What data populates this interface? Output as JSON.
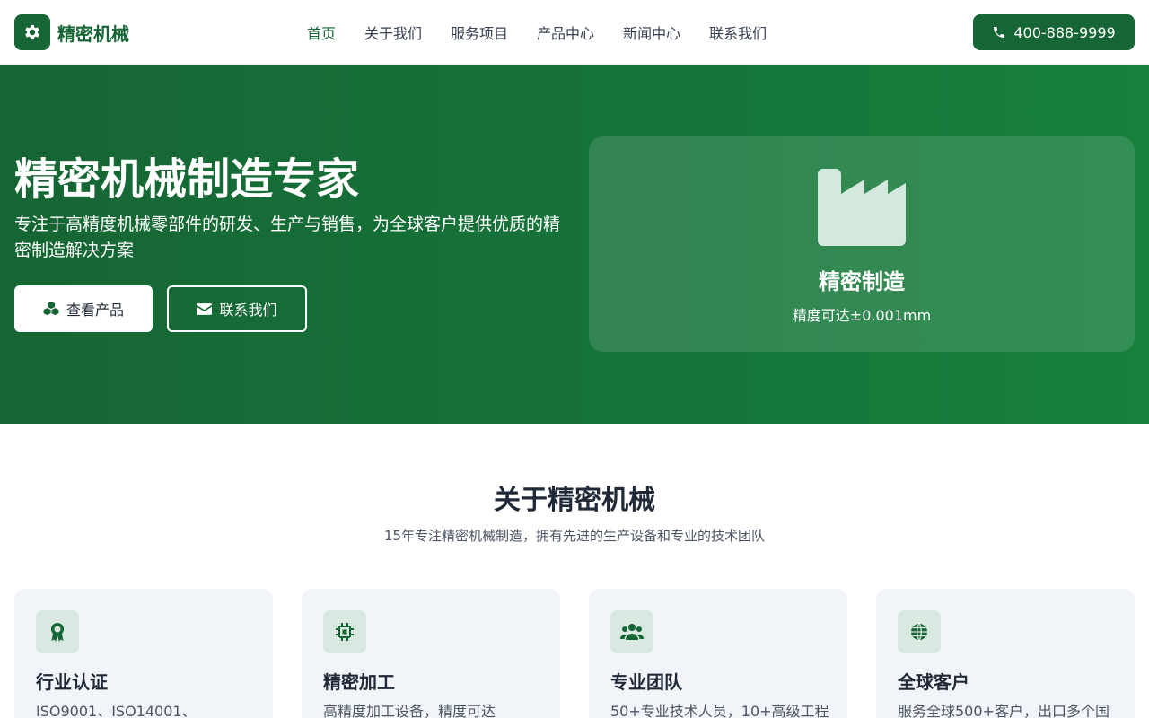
{
  "brand": {
    "name": "精密机械",
    "accent_color": "#166534",
    "logo_icon": "gear-icon"
  },
  "nav": {
    "items": [
      {
        "label": "首页",
        "active": true
      },
      {
        "label": "关于我们",
        "active": false
      },
      {
        "label": "服务项目",
        "active": false
      },
      {
        "label": "产品中心",
        "active": false
      },
      {
        "label": "新闻中心",
        "active": false
      },
      {
        "label": "联系我们",
        "active": false
      }
    ],
    "phone": "400-888-9999",
    "phone_icon": "phone-icon"
  },
  "hero": {
    "title": "精密机械制造专家",
    "description": "专注于高精度机械零部件的研发、生产与销售，为全球客户提供优质的精密制造解决方案",
    "primary_button": "查看产品",
    "primary_icon": "cubes-icon",
    "secondary_button": "联系我们",
    "secondary_icon": "envelope-icon",
    "card": {
      "icon": "factory-icon",
      "title": "精密制造",
      "subtitle": "精度可达±0.001mm"
    }
  },
  "about": {
    "title": "关于精密机械",
    "subtitle": "15年专注精密机械制造，拥有先进的生产设备和专业的技术团队",
    "features": [
      {
        "icon": "award-icon",
        "title": "行业认证",
        "desc": "ISO9001、ISO14001、"
      },
      {
        "icon": "chip-icon",
        "title": "精密加工",
        "desc": "高精度加工设备，精度可达"
      },
      {
        "icon": "team-icon",
        "title": "专业团队",
        "desc": "50+专业技术人员，10+高级工程"
      },
      {
        "icon": "globe-icon",
        "title": "全球客户",
        "desc": "服务全球500+客户，出口多个国"
      }
    ]
  }
}
